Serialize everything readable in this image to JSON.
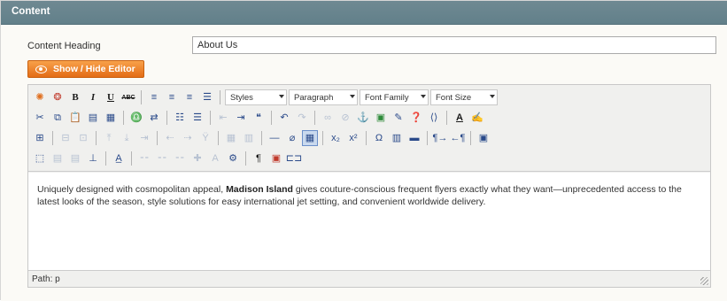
{
  "panel": {
    "title": "Content"
  },
  "form": {
    "heading_label": "Content Heading",
    "heading_value": "About Us",
    "toggle_label": "Show / Hide Editor"
  },
  "toolbar": {
    "styles_label": "Styles",
    "format_label": "Paragraph",
    "font_family_label": "Font Family",
    "font_size_label": "Font Size"
  },
  "editor": {
    "content_before": "Uniquely designed with cosmopolitan appeal, ",
    "content_bold": "Madison Island",
    "content_after": " gives couture-conscious frequent flyers exactly what they want—unprecedented access to the latest looks of the season, style solutions for easy international jet setting, and convenient worldwide delivery.",
    "path_label": "Path: p"
  },
  "icons": [
    "magento-widget-icon",
    "image-icon",
    "bold-icon",
    "italic-icon",
    "underline-icon",
    "strikethrough-icon",
    "align-left-icon",
    "align-center-icon",
    "align-right-icon",
    "align-justify-icon",
    "cut-icon",
    "copy-icon",
    "paste-icon",
    "paste-text-icon",
    "paste-word-icon",
    "find-icon",
    "replace-icon",
    "bullet-list-icon",
    "numbered-list-icon",
    "outdent-icon",
    "indent-icon",
    "blockquote-icon",
    "undo-icon",
    "redo-icon",
    "link-icon",
    "unlink-icon",
    "anchor-icon",
    "image-insert-icon",
    "cleanup-icon",
    "help-icon",
    "html-icon",
    "text-color-icon",
    "highlight-color-icon",
    "table-icon",
    "horizontal-rule-icon",
    "remove-format-icon",
    "visual-aid-icon",
    "subscript-icon",
    "superscript-icon",
    "special-char-icon",
    "media-icon",
    "advanced-hr-icon",
    "ltr-icon",
    "rtl-icon",
    "fullscreen-icon",
    "layer-icon",
    "show-blocks-icon",
    "nonbreaking-icon",
    "page-break-icon"
  ]
}
